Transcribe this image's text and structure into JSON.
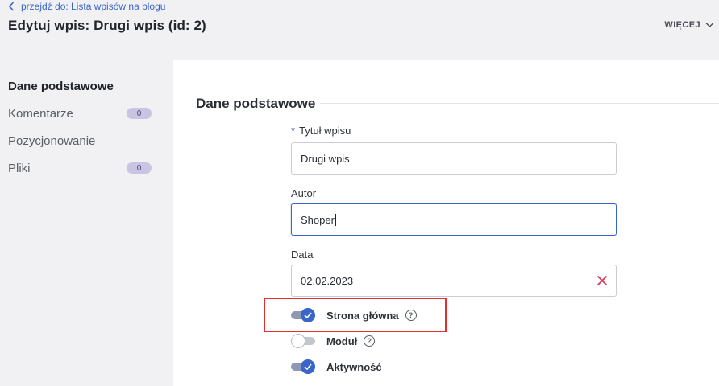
{
  "header": {
    "back_link": "przejdź do: Lista wpisów na blogu",
    "title": "Edytuj wpis: Drugi wpis (id: 2)",
    "more_label": "WIĘCEJ"
  },
  "sidebar": {
    "items": [
      {
        "label": "Dane podstawowe",
        "active": true
      },
      {
        "label": "Komentarze",
        "badge": "0"
      },
      {
        "label": "Pozycjonowanie"
      },
      {
        "label": "Pliki",
        "badge": "0"
      }
    ]
  },
  "section": {
    "title": "Dane podstawowe"
  },
  "form": {
    "title_field": {
      "label": "Tytuł wpisu",
      "required_mark": "*",
      "value": "Drugi wpis"
    },
    "author_field": {
      "label": "Autor",
      "value": "Shoper"
    },
    "date_field": {
      "label": "Data",
      "value": "02.02.2023"
    },
    "toggles": [
      {
        "label": "Strona główna",
        "on": true,
        "help": "?"
      },
      {
        "label": "Moduł",
        "on": false,
        "help": "?"
      },
      {
        "label": "Aktywność",
        "on": true
      }
    ]
  },
  "colors": {
    "accent": "#3a66c9",
    "highlight": "#e0312f",
    "clear_icon": "#d9365a"
  },
  "icons": [
    "chevron-left-icon",
    "chevron-down-icon",
    "clear-icon",
    "checkmark-icon",
    "help-icon"
  ]
}
